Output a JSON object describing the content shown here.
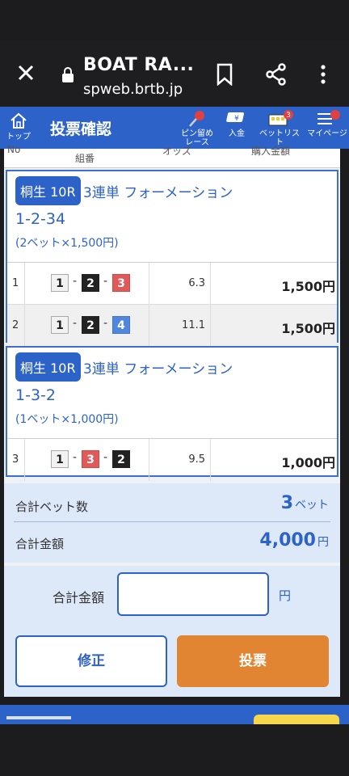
{
  "browser": {
    "title": "BOAT RA...",
    "url": "spweb.brtb.jp"
  },
  "header": {
    "home_label": "トップ",
    "page_title": "投票確認",
    "icons": [
      {
        "name": "pin-icon",
        "label": "ピン留め\nレース"
      },
      {
        "name": "deposit-icon",
        "label": "入金"
      },
      {
        "name": "betlist-icon",
        "label": "ベットリスト",
        "badge": "3"
      },
      {
        "name": "mypage-icon",
        "label": "マイページ"
      }
    ]
  },
  "columns": {
    "no": "No",
    "combination": "組番",
    "odds": "オッズ",
    "amount": "購入金額"
  },
  "tickets": [
    {
      "venue": "桐生 10R",
      "bet_type": "3連単 フォーメーション",
      "combo": "1-2-34",
      "bet_count": "(2ベット×1,500円)",
      "rows": [
        {
          "no": "1",
          "boats": [
            "1",
            "2",
            "3"
          ],
          "odds": "6.3",
          "amount": "1,500円"
        },
        {
          "no": "2",
          "boats": [
            "1",
            "2",
            "4"
          ],
          "odds": "11.1",
          "amount": "1,500円"
        }
      ]
    },
    {
      "venue": "桐生 10R",
      "bet_type": "3連単 フォーメーション",
      "combo": "1-3-2",
      "bet_count": "(1ベット×1,000円)",
      "rows": [
        {
          "no": "3",
          "boats": [
            "1",
            "3",
            "2"
          ],
          "odds": "9.5",
          "amount": "1,000円"
        }
      ]
    }
  ],
  "summary": {
    "bet_count_label": "合計ベット数",
    "bet_count_value": "3",
    "bet_count_unit": "ベット",
    "total_label": "合計金額",
    "total_value": "4,000",
    "total_unit": "円"
  },
  "confirm": {
    "total_label": "合計金額",
    "input_value": "",
    "unit": "円",
    "fix_button": "修正",
    "vote_button": "投票"
  },
  "colors": {
    "brand_blue": "#2d63c8",
    "vote_orange": "#e28533",
    "boat1": "#f2f2f2",
    "boat2": "#222222",
    "boat3": "#e05a5a",
    "boat4": "#4f86e0"
  }
}
